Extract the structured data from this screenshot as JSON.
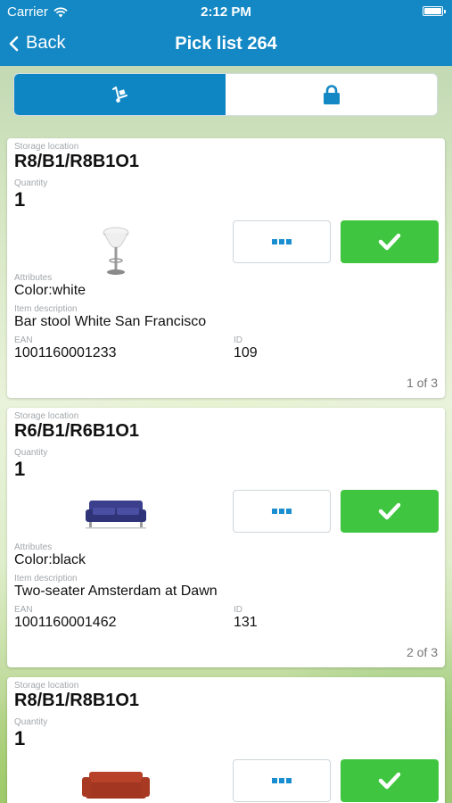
{
  "status_bar": {
    "carrier": "Carrier",
    "time": "2:12 PM"
  },
  "nav": {
    "back_label": "Back",
    "title": "Pick list 264"
  },
  "segments": [
    {
      "icon": "hand-truck-icon",
      "active": true
    },
    {
      "icon": "lock-icon",
      "active": false
    }
  ],
  "labels": {
    "storage_location": "Storage location",
    "quantity": "Quantity",
    "attributes": "Attributes",
    "item_description": "Item description",
    "ean": "EAN",
    "id": "ID"
  },
  "items": [
    {
      "storage_location": "R8/B1/R8B1O1",
      "quantity": "1",
      "image": "bar-stool-image",
      "attributes": "Color:white",
      "description": "Bar stool White San Francisco",
      "ean": "1001160001233",
      "id": "109",
      "pager": "1 of 3"
    },
    {
      "storage_location": "R6/B1/R6B1O1",
      "quantity": "1",
      "image": "blue-sofa-image",
      "attributes": "Color:black",
      "description": "Two-seater Amsterdam at Dawn",
      "ean": "1001160001462",
      "id": "131",
      "pager": "2 of 3"
    },
    {
      "storage_location": "R8/B1/R8B1O1",
      "quantity": "1",
      "image": "red-sofa-image"
    }
  ],
  "colors": {
    "nav_blue": "#1488c4",
    "confirm_green": "#3fc53f",
    "more_dots_blue": "#1a8ed0"
  }
}
